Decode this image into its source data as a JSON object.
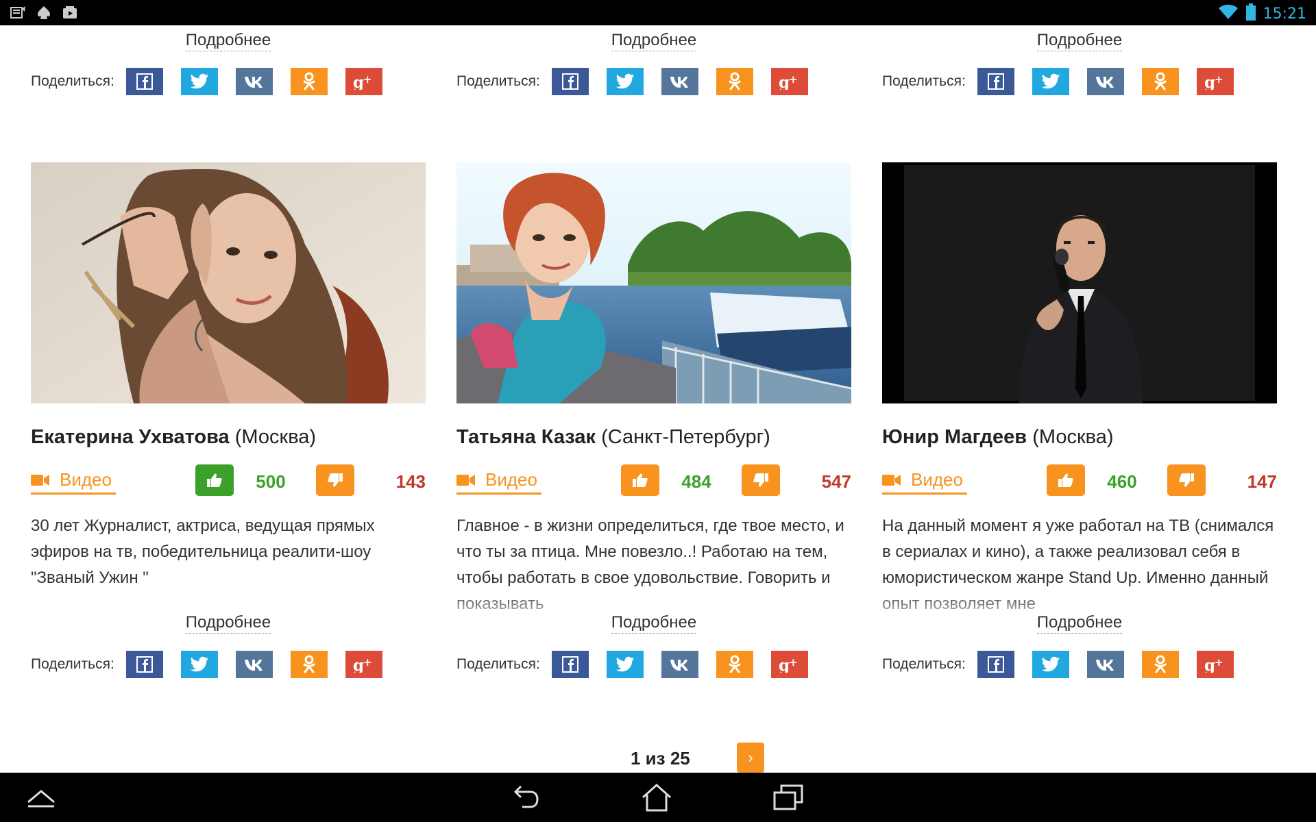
{
  "status_bar": {
    "time": "15:21",
    "icon_color": "#33b5e5"
  },
  "common": {
    "more_label": "Подробнее",
    "share_label": "Поделиться:",
    "video_label": "Видео",
    "share_icons": [
      "facebook-icon",
      "twitter-icon",
      "vk-icon",
      "odnoklassniki-icon",
      "google-plus-icon"
    ]
  },
  "colors": {
    "accent": "#f7931e",
    "like_green": "#3ba12b",
    "dislike_red": "#c0392b",
    "facebook": "#3b5998",
    "twitter": "#21a8e0",
    "vk": "#54769a",
    "odnoklassniki": "#f7931e",
    "google_plus": "#dd4b39"
  },
  "cards": [
    {
      "name": "Екатерина Ухватова",
      "city": "(Москва)",
      "likes": "500",
      "dislikes": "143",
      "like_active": true,
      "description": "30 лет Журналист, актриса, ведущая прямых эфиров на тв, победительница реалити-шоу \"Званый Ужин \""
    },
    {
      "name": "Татьяна Казак",
      "city": "(Санкт-Петербург)",
      "likes": "484",
      "dislikes": "547",
      "like_active": false,
      "description": "Главное - в жизни определиться, где твое место, и что ты за птица. Мне повезло..! Работаю на тем, чтобы работать в свое удовольствие. Говорить и показывать"
    },
    {
      "name": "Юнир Магдеев",
      "city": "(Москва)",
      "likes": "460",
      "dislikes": "147",
      "like_active": false,
      "description": "На данный момент я уже работал на ТВ (снимался в сериалах и кино), а также реализовал себя в юмористическом жанре Stand Up. Именно данный опыт позволяет мне"
    }
  ],
  "pagination": {
    "text": "1 из 25",
    "next_label": "›"
  }
}
